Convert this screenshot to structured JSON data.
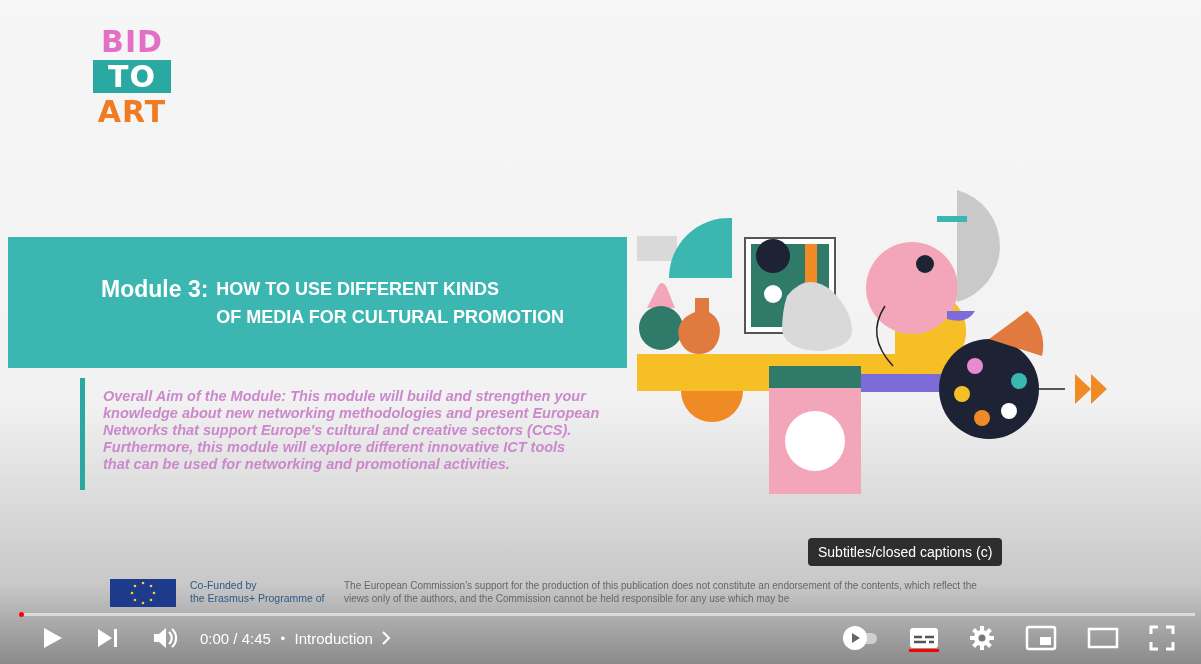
{
  "slide": {
    "logo": [
      "BID",
      "TO",
      "ART"
    ],
    "title_label": "Module 3:",
    "title_lines": [
      "HOW TO USE DIFFERENT KINDS",
      "OF MEDIA FOR CULTURAL PROMOTION"
    ],
    "aim_lines": [
      "Overall Aim of the Module: This module will build and strengthen your",
      "knowledge about new networking methodologies and present European",
      "Networks that support Europe's cultural and creative sectors (CCS).",
      "Furthermore, this module will explore different innovative ICT tools",
      "that can be used for networking and promotional activities."
    ],
    "funder_lines": [
      "Co-Funded by",
      "the Erasmus+ Programme of"
    ],
    "disclaimer_lines": [
      "The European Commission's support for the production of this publication does not constitute an endorsement of the contents, which reflect the",
      "views only of the authors, and the Commission cannot be held responsible for any use which may be"
    ]
  },
  "tooltip": "Subtitles/closed captions (c)",
  "player": {
    "progress": {
      "level": 0.0
    },
    "time": "0:00 / 4:45",
    "separator": "•",
    "chapter": "Introduction",
    "autoplay": {
      "on": false
    },
    "captions": {
      "on": true
    }
  }
}
